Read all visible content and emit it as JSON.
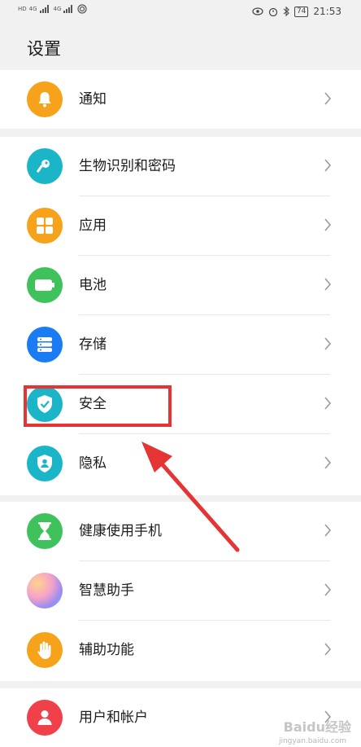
{
  "status_bar": {
    "left_labels": [
      "HD",
      "4G",
      "4G"
    ],
    "time": "21:53",
    "battery": "74"
  },
  "page": {
    "title": "设置"
  },
  "settings": [
    {
      "label": "通知",
      "icon": "bell-icon",
      "color": "#F7A21B"
    },
    {
      "label": "生物识别和密码",
      "icon": "key-icon",
      "color": "#1AB6C8"
    },
    {
      "label": "应用",
      "icon": "apps-grid-icon",
      "color": "#F7A21B"
    },
    {
      "label": "电池",
      "icon": "battery-icon",
      "color": "#3FC25B"
    },
    {
      "label": "存储",
      "icon": "storage-icon",
      "color": "#1B7BF2"
    },
    {
      "label": "安全",
      "icon": "shield-check-icon",
      "color": "#1AB6C8"
    },
    {
      "label": "隐私",
      "icon": "privacy-shield-icon",
      "color": "#1AB6C8"
    },
    {
      "label": "健康使用手机",
      "icon": "hourglass-icon",
      "color": "#3FC25B"
    },
    {
      "label": "智慧助手",
      "icon": "assistant-orb-icon",
      "color": "#B58CF0"
    },
    {
      "label": "辅助功能",
      "icon": "hand-icon",
      "color": "#F7A21B"
    },
    {
      "label": "用户和帐户",
      "icon": "user-icon",
      "color": "#F0414B"
    }
  ],
  "annotation": {
    "color": "#E63333"
  },
  "watermark": {
    "text": "Baidu经验",
    "sub": "jingyan.baidu.com"
  }
}
